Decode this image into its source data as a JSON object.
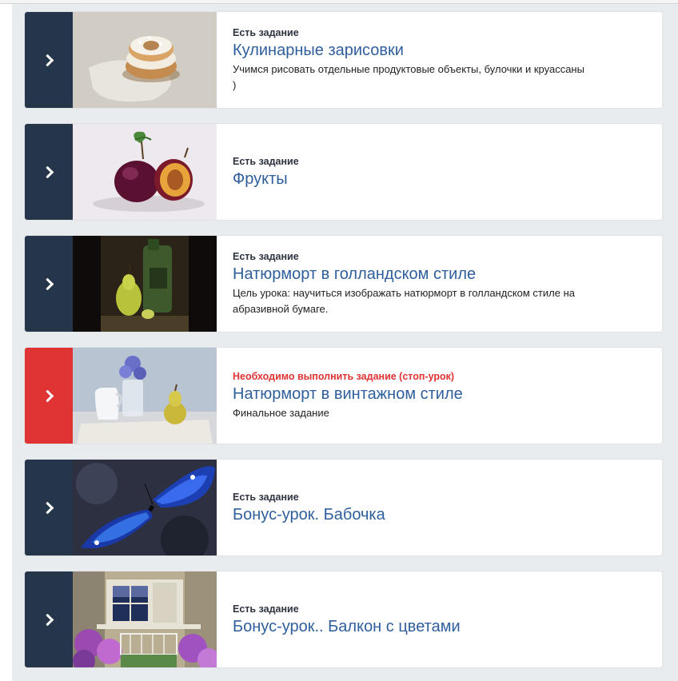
{
  "lessons": [
    {
      "status": "Есть задание",
      "status_type": "normal",
      "title": "Кулинарные зарисовки",
      "description": "Учимся рисовать отдельные продуктовые объекты, булочки и круассаны )",
      "image": "pastry-painting"
    },
    {
      "status": "Есть задание",
      "status_type": "normal",
      "title": "Фрукты",
      "description": "",
      "image": "plums-painting"
    },
    {
      "status": "Есть задание",
      "status_type": "normal",
      "title": "Натюрморт в голландском стиле",
      "description": "Цель урока: научиться изображать натюрморт в голландском стиле на абразивной бумаге.",
      "image": "dutch-still-life-painting"
    },
    {
      "status": "Необходимо выполнить задание (стоп-урок)",
      "status_type": "stop",
      "title": "Натюрморт в винтажном стиле",
      "description": "Финальное задание",
      "image": "vintage-still-life-painting"
    },
    {
      "status": "Есть задание",
      "status_type": "normal",
      "title": "Бонус-урок. Бабочка",
      "description": "",
      "image": "butterfly-painting"
    },
    {
      "status": "Есть задание",
      "status_type": "normal",
      "title": "Бонус-урок.. Балкон с цветами",
      "description": "",
      "image": "balcony-flowers-painting"
    }
  ],
  "colors": {
    "arrow_default": "#25364a",
    "arrow_stop": "#e03434",
    "title": "#2f5e9c",
    "status_stop": "#e03434"
  }
}
